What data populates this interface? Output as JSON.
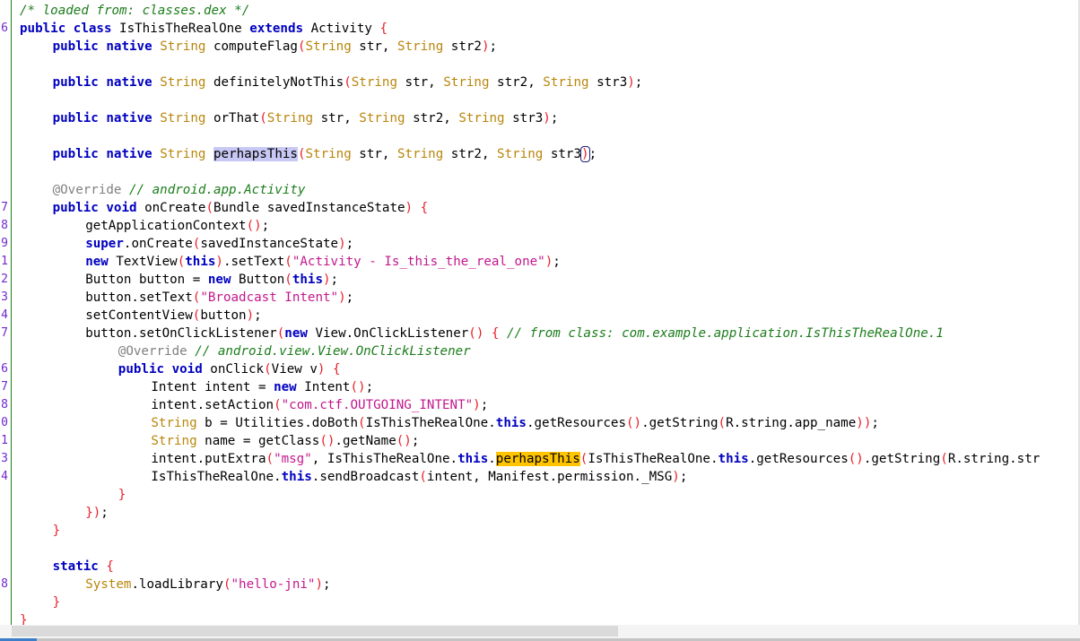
{
  "editor": {
    "header_comment": "/* loaded from: classes.dex */",
    "gutter_numbers": [
      {
        "row": 1,
        "label": "6"
      },
      {
        "row": 11,
        "label": "7"
      },
      {
        "row": 12,
        "label": "8"
      },
      {
        "row": 13,
        "label": "9"
      },
      {
        "row": 14,
        "label": "1"
      },
      {
        "row": 15,
        "label": "2"
      },
      {
        "row": 16,
        "label": "3"
      },
      {
        "row": 17,
        "label": "4"
      },
      {
        "row": 18,
        "label": "7"
      },
      {
        "row": 20,
        "label": "6"
      },
      {
        "row": 21,
        "label": "7"
      },
      {
        "row": 22,
        "label": "8"
      },
      {
        "row": 23,
        "label": "0"
      },
      {
        "row": 24,
        "label": "1"
      },
      {
        "row": 25,
        "label": "3"
      },
      {
        "row": 26,
        "label": "4"
      },
      {
        "row": 32,
        "label": "8"
      }
    ],
    "lines": [
      {
        "indent": 0,
        "tokens": [
          [
            "cm",
            "/* loaded from: classes.dex */"
          ]
        ]
      },
      {
        "indent": 0,
        "tokens": [
          [
            "kw",
            "public"
          ],
          [
            "",
            " "
          ],
          [
            "kw",
            "class"
          ],
          [
            "",
            " IsThisTheRealOne "
          ],
          [
            "kw",
            "extends"
          ],
          [
            "",
            " Activity "
          ],
          [
            "br",
            "{"
          ]
        ]
      },
      {
        "indent": 1,
        "tokens": [
          [
            "kw",
            "public"
          ],
          [
            "",
            " "
          ],
          [
            "kw",
            "native"
          ],
          [
            "",
            " "
          ],
          [
            "ty",
            "String"
          ],
          [
            "",
            " computeFlag"
          ],
          [
            "br",
            "("
          ],
          [
            "ty",
            "String"
          ],
          [
            "",
            " str, "
          ],
          [
            "ty",
            "String"
          ],
          [
            "",
            " str2"
          ],
          [
            "br",
            ")"
          ],
          [
            "",
            ";"
          ]
        ]
      },
      {
        "indent": 0,
        "tokens": []
      },
      {
        "indent": 1,
        "tokens": [
          [
            "kw",
            "public"
          ],
          [
            "",
            " "
          ],
          [
            "kw",
            "native"
          ],
          [
            "",
            " "
          ],
          [
            "ty",
            "String"
          ],
          [
            "",
            " definitelyNotThis"
          ],
          [
            "br",
            "("
          ],
          [
            "ty",
            "String"
          ],
          [
            "",
            " str, "
          ],
          [
            "ty",
            "String"
          ],
          [
            "",
            " str2, "
          ],
          [
            "ty",
            "String"
          ],
          [
            "",
            " str3"
          ],
          [
            "br",
            ")"
          ],
          [
            "",
            ";"
          ]
        ]
      },
      {
        "indent": 0,
        "tokens": []
      },
      {
        "indent": 1,
        "tokens": [
          [
            "kw",
            "public"
          ],
          [
            "",
            " "
          ],
          [
            "kw",
            "native"
          ],
          [
            "",
            " "
          ],
          [
            "ty",
            "String"
          ],
          [
            "",
            " orThat"
          ],
          [
            "br",
            "("
          ],
          [
            "ty",
            "String"
          ],
          [
            "",
            " str, "
          ],
          [
            "ty",
            "String"
          ],
          [
            "",
            " str2, "
          ],
          [
            "ty",
            "String"
          ],
          [
            "",
            " str3"
          ],
          [
            "br",
            ")"
          ],
          [
            "",
            ";"
          ]
        ]
      },
      {
        "indent": 0,
        "tokens": []
      },
      {
        "indent": 1,
        "tokens": [
          [
            "kw",
            "public"
          ],
          [
            "",
            " "
          ],
          [
            "kw",
            "native"
          ],
          [
            "",
            " "
          ],
          [
            "ty",
            "String"
          ],
          [
            "",
            " "
          ],
          [
            "hl-sel",
            "perhapsThis"
          ],
          [
            "br",
            "("
          ],
          [
            "ty",
            "String"
          ],
          [
            "",
            " str, "
          ],
          [
            "ty",
            "String"
          ],
          [
            "",
            " str2, "
          ],
          [
            "ty",
            "String"
          ],
          [
            "",
            " str3"
          ],
          [
            "br caret-box",
            ")"
          ],
          [
            "",
            ";"
          ]
        ]
      },
      {
        "indent": 0,
        "tokens": []
      },
      {
        "indent": 1,
        "tokens": [
          [
            "an",
            "@Override"
          ],
          [
            "",
            " "
          ],
          [
            "cm",
            "// android.app.Activity"
          ]
        ]
      },
      {
        "indent": 1,
        "tokens": [
          [
            "kw",
            "public"
          ],
          [
            "",
            " "
          ],
          [
            "kw",
            "void"
          ],
          [
            "",
            " onCreate"
          ],
          [
            "br",
            "("
          ],
          [
            "",
            "Bundle savedInstanceState"
          ],
          [
            "br",
            ")"
          ],
          [
            "",
            " "
          ],
          [
            "br",
            "{"
          ]
        ]
      },
      {
        "indent": 2,
        "tokens": [
          [
            "",
            "getApplicationContext"
          ],
          [
            "br",
            "()"
          ],
          [
            "",
            ";"
          ]
        ]
      },
      {
        "indent": 2,
        "tokens": [
          [
            "kw",
            "super"
          ],
          [
            "",
            ".onCreate"
          ],
          [
            "br",
            "("
          ],
          [
            "",
            "savedInstanceState"
          ],
          [
            "br",
            ")"
          ],
          [
            "",
            ";"
          ]
        ]
      },
      {
        "indent": 2,
        "tokens": [
          [
            "kw",
            "new"
          ],
          [
            "",
            " TextView"
          ],
          [
            "br",
            "("
          ],
          [
            "kw",
            "this"
          ],
          [
            "br",
            ")"
          ],
          [
            "",
            ".setText"
          ],
          [
            "br",
            "("
          ],
          [
            "st",
            "\"Activity - Is_this_the_real_one\""
          ],
          [
            "br",
            ")"
          ],
          [
            "",
            ";"
          ]
        ]
      },
      {
        "indent": 2,
        "tokens": [
          [
            "",
            "Button button = "
          ],
          [
            "kw",
            "new"
          ],
          [
            "",
            " Button"
          ],
          [
            "br",
            "("
          ],
          [
            "kw",
            "this"
          ],
          [
            "br",
            ")"
          ],
          [
            "",
            ";"
          ]
        ]
      },
      {
        "indent": 2,
        "tokens": [
          [
            "",
            "button.setText"
          ],
          [
            "br",
            "("
          ],
          [
            "st",
            "\"Broadcast Intent\""
          ],
          [
            "br",
            ")"
          ],
          [
            "",
            ";"
          ]
        ]
      },
      {
        "indent": 2,
        "tokens": [
          [
            "",
            "setContentView"
          ],
          [
            "br",
            "("
          ],
          [
            "",
            "button"
          ],
          [
            "br",
            ")"
          ],
          [
            "",
            ";"
          ]
        ]
      },
      {
        "indent": 2,
        "tokens": [
          [
            "",
            "button.setOnClickListener"
          ],
          [
            "br",
            "("
          ],
          [
            "kw",
            "new"
          ],
          [
            "",
            " View.OnClickListener"
          ],
          [
            "br",
            "()"
          ],
          [
            "",
            " "
          ],
          [
            "br",
            "{"
          ],
          [
            "",
            " "
          ],
          [
            "cm",
            "// from class: com.example.application.IsThisTheRealOne.1"
          ]
        ]
      },
      {
        "indent": 3,
        "tokens": [
          [
            "an",
            "@Override"
          ],
          [
            "",
            " "
          ],
          [
            "cm",
            "// android.view.View.OnClickListener"
          ]
        ]
      },
      {
        "indent": 3,
        "tokens": [
          [
            "kw",
            "public"
          ],
          [
            "",
            " "
          ],
          [
            "kw",
            "void"
          ],
          [
            "",
            " onClick"
          ],
          [
            "br",
            "("
          ],
          [
            "",
            "View v"
          ],
          [
            "br",
            ")"
          ],
          [
            "",
            " "
          ],
          [
            "br",
            "{"
          ]
        ]
      },
      {
        "indent": 4,
        "tokens": [
          [
            "",
            "Intent intent = "
          ],
          [
            "kw",
            "new"
          ],
          [
            "",
            " Intent"
          ],
          [
            "br",
            "()"
          ],
          [
            "",
            ";"
          ]
        ]
      },
      {
        "indent": 4,
        "tokens": [
          [
            "",
            "intent.setAction"
          ],
          [
            "br",
            "("
          ],
          [
            "st",
            "\"com.ctf.OUTGOING_INTENT\""
          ],
          [
            "br",
            ")"
          ],
          [
            "",
            ";"
          ]
        ]
      },
      {
        "indent": 4,
        "tokens": [
          [
            "ty",
            "String"
          ],
          [
            "",
            " b = Utilities.doBoth"
          ],
          [
            "br",
            "("
          ],
          [
            "",
            "IsThisTheRealOne."
          ],
          [
            "kw",
            "this"
          ],
          [
            "",
            ".getResources"
          ],
          [
            "br",
            "()"
          ],
          [
            "",
            ".getString"
          ],
          [
            "br",
            "("
          ],
          [
            "",
            "R.string.app_name"
          ],
          [
            "br",
            "))"
          ],
          [
            "",
            ";"
          ]
        ]
      },
      {
        "indent": 4,
        "tokens": [
          [
            "ty",
            "String"
          ],
          [
            "",
            " name = getClass"
          ],
          [
            "br",
            "()"
          ],
          [
            "",
            ".getName"
          ],
          [
            "br",
            "()"
          ],
          [
            "",
            ";"
          ]
        ]
      },
      {
        "indent": 4,
        "tokens": [
          [
            "",
            "intent.putExtra"
          ],
          [
            "br",
            "("
          ],
          [
            "st",
            "\"msg\""
          ],
          [
            "",
            ", IsThisTheRealOne."
          ],
          [
            "kw",
            "this"
          ],
          [
            "",
            "."
          ],
          [
            "hl-occ",
            "perhapsThis"
          ],
          [
            "br",
            "("
          ],
          [
            "",
            "IsThisTheRealOne."
          ],
          [
            "kw",
            "this"
          ],
          [
            "",
            ".getResources"
          ],
          [
            "br",
            "()"
          ],
          [
            "",
            ".getString"
          ],
          [
            "br",
            "("
          ],
          [
            "",
            "R.string.str"
          ]
        ]
      },
      {
        "indent": 4,
        "tokens": [
          [
            "",
            "IsThisTheRealOne."
          ],
          [
            "kw",
            "this"
          ],
          [
            "",
            ".sendBroadcast"
          ],
          [
            "br",
            "("
          ],
          [
            "",
            "intent, Manifest.permission._MSG"
          ],
          [
            "br",
            ")"
          ],
          [
            "",
            ";"
          ]
        ]
      },
      {
        "indent": 3,
        "tokens": [
          [
            "br",
            "}"
          ]
        ]
      },
      {
        "indent": 2,
        "tokens": [
          [
            "br",
            "})"
          ],
          [
            "",
            ";"
          ]
        ]
      },
      {
        "indent": 1,
        "tokens": [
          [
            "br",
            "}"
          ]
        ]
      },
      {
        "indent": 0,
        "tokens": []
      },
      {
        "indent": 1,
        "tokens": [
          [
            "kw",
            "static"
          ],
          [
            "",
            " "
          ],
          [
            "br",
            "{"
          ]
        ]
      },
      {
        "indent": 2,
        "tokens": [
          [
            "ty",
            "System"
          ],
          [
            "",
            ".loadLibrary"
          ],
          [
            "br",
            "("
          ],
          [
            "st",
            "\"hello-jni\""
          ],
          [
            "br",
            ")"
          ],
          [
            "",
            ";"
          ]
        ]
      },
      {
        "indent": 1,
        "tokens": [
          [
            "br",
            "}"
          ]
        ]
      },
      {
        "indent": 0,
        "tokens": [
          [
            "br",
            "}"
          ]
        ]
      }
    ]
  },
  "colors": {
    "keyword": "#0000c0",
    "type": "#b8860b",
    "bracket": "#e8202a",
    "string": "#c2188c",
    "comment": "#1c7d1c",
    "annotation": "#808080",
    "line_number": "#6d2ad0",
    "selection_highlight": "#c8c8f4",
    "occurrence_highlight": "#ffc400"
  },
  "scrollbar": {
    "horizontal_position_fraction": 0.0,
    "visible_fraction": 0.57
  }
}
